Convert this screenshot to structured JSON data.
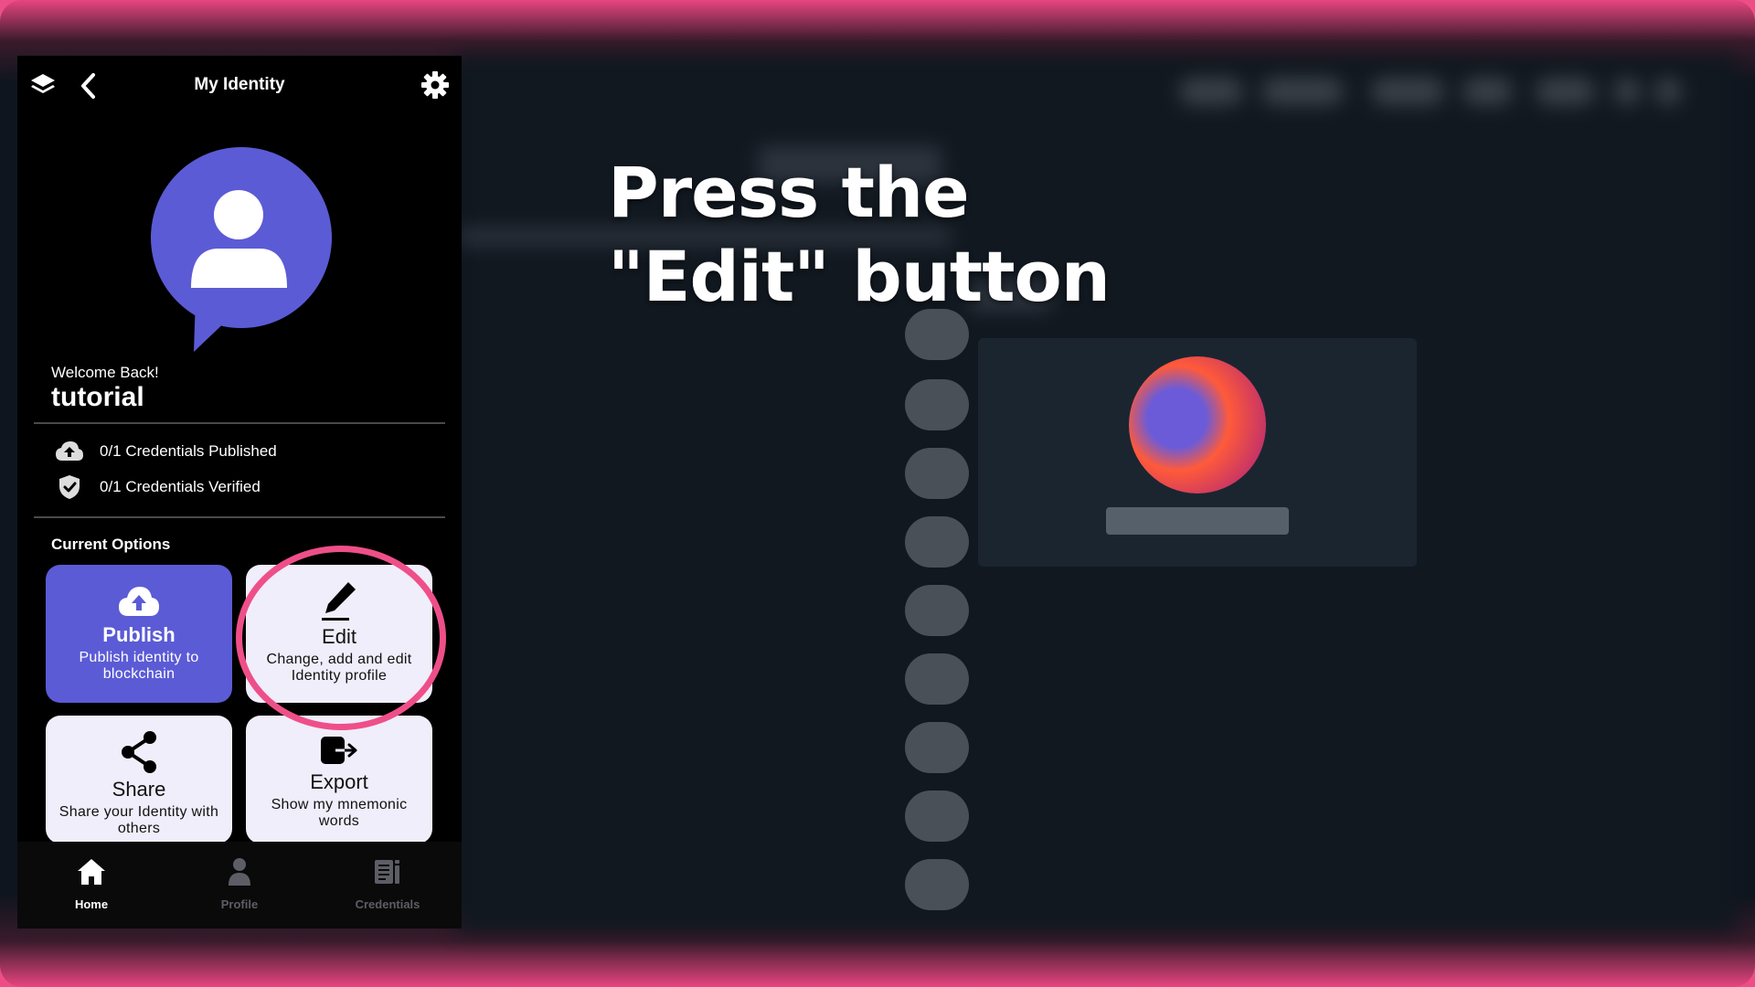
{
  "instruction": {
    "text": "Press the \"Edit\" button"
  },
  "app": {
    "title": "My Identity",
    "welcome": "Welcome Back!",
    "username": "tutorial",
    "stats": {
      "published": "0/1 Credentials Published",
      "verified": "0/1 Credentials Verified"
    },
    "section_label": "Current Options",
    "options": {
      "publish": {
        "title": "Publish",
        "description": "Publish identity to blockchain"
      },
      "edit": {
        "title": "Edit",
        "description": "Change, add and edit Identity profile"
      },
      "share": {
        "title": "Share",
        "description": "Share your Identity with others"
      },
      "export": {
        "title": "Export",
        "description": "Show my mnemonic words"
      }
    },
    "nav": {
      "home": "Home",
      "profile": "Profile",
      "credentials": "Credentials",
      "active": "Home"
    },
    "icons": {
      "top_left": "layers-icon",
      "back": "back-arrow-icon",
      "settings": "gear-icon",
      "avatar": "user-speech-bubble-icon",
      "published": "cloud-upload-icon",
      "verified": "shield-check-icon",
      "publish": "cloud-upload-icon",
      "edit": "pencil-icon",
      "share": "share-icon",
      "export": "export-icon",
      "home": "home-icon",
      "profile": "person-icon",
      "credentials": "document-icon"
    }
  },
  "colors": {
    "frame": "#ee4e86",
    "accent": "#5b5bd6",
    "highlight": "#ef4f89",
    "card_light": "#efeefa"
  }
}
